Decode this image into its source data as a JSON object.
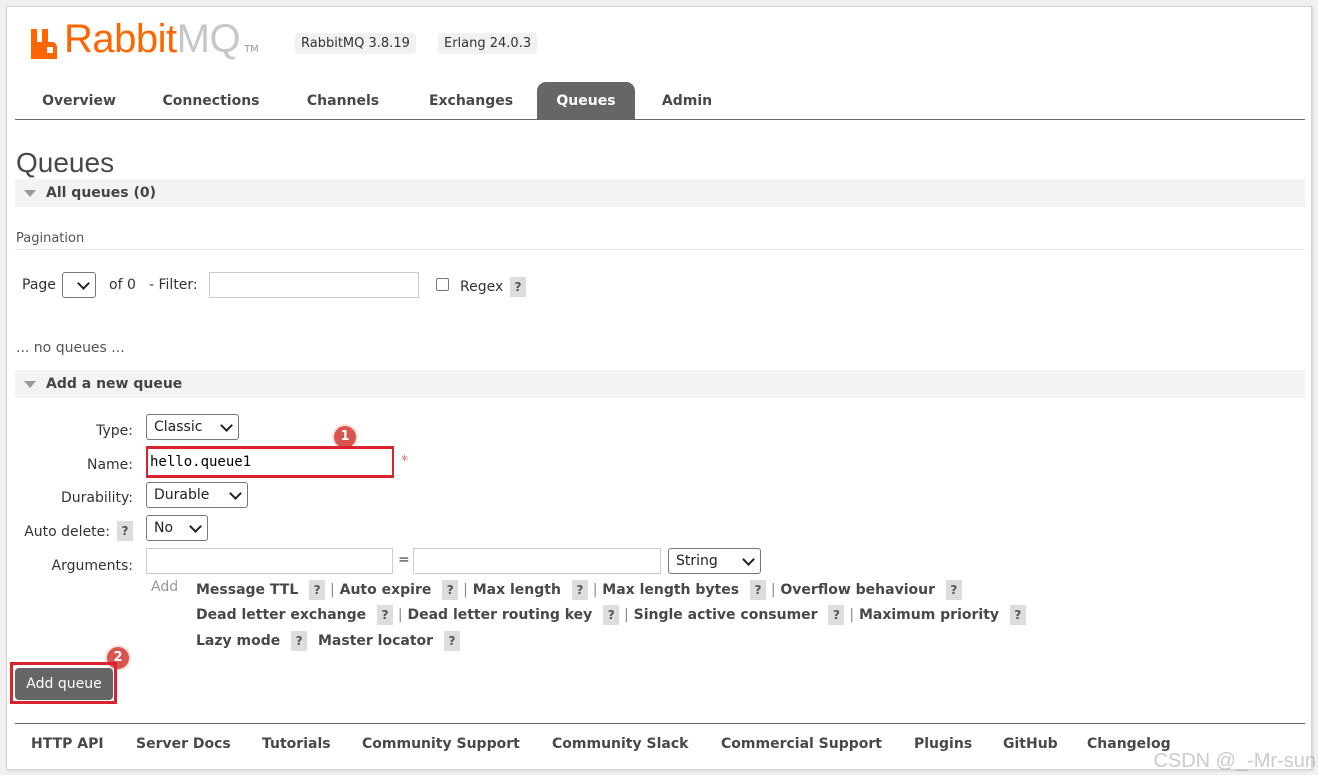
{
  "header": {
    "logo_brand": "Rabbit",
    "logo_suffix": "MQ",
    "logo_tm": "TM",
    "version": "RabbitMQ 3.8.19",
    "erlang": "Erlang 24.0.3",
    "brand_color": "#ff6600"
  },
  "tabs": [
    {
      "label": "Overview",
      "active": false
    },
    {
      "label": "Connections",
      "active": false
    },
    {
      "label": "Channels",
      "active": false
    },
    {
      "label": "Exchanges",
      "active": false
    },
    {
      "label": "Queues",
      "active": true
    },
    {
      "label": "Admin",
      "active": false
    }
  ],
  "page_title": "Queues",
  "all_queues": {
    "title": "All queues (0)",
    "pagination_label": "Pagination",
    "page_label": "Page",
    "of_label": "of 0",
    "filter_label": "- Filter:",
    "filter_value": "",
    "regex_label": "Regex",
    "help": "?",
    "empty_text": "... no queues ..."
  },
  "add_queue": {
    "title": "Add a new queue",
    "type_label": "Type:",
    "type_value": "Classic",
    "name_label": "Name:",
    "name_value": "hello.queue1",
    "required_mark": "*",
    "durability_label": "Durability:",
    "durability_value": "Durable",
    "auto_delete_label": "Auto delete:",
    "auto_delete_value": "No",
    "arguments_label": "Arguments:",
    "arg_key": "",
    "arg_equals": "=",
    "arg_value": "",
    "arg_type": "String",
    "add_label": "Add",
    "options_row1": [
      "Message TTL",
      "Auto expire",
      "Max length",
      "Max length bytes",
      "Overflow behaviour"
    ],
    "options_row2": [
      "Dead letter exchange",
      "Dead letter routing key",
      "Single active consumer",
      "Maximum priority"
    ],
    "options_row3": [
      "Lazy mode",
      "Master locator"
    ],
    "submit_label": "Add queue"
  },
  "annotations": {
    "badge1": "1",
    "badge2": "2",
    "highlight_color": "#d9232e"
  },
  "footer": [
    "HTTP API",
    "Server Docs",
    "Tutorials",
    "Community Support",
    "Community Slack",
    "Commercial Support",
    "Plugins",
    "GitHub",
    "Changelog"
  ],
  "watermark": "CSDN @_-Mr-sun"
}
